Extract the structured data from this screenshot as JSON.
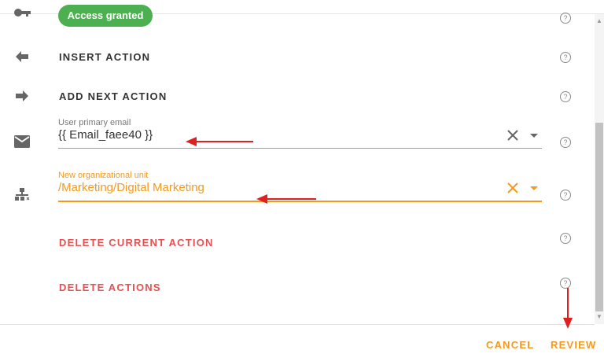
{
  "status_pill": {
    "label": "Access granted",
    "color": "#4caf50"
  },
  "actions": {
    "insert_label": "INSERT ACTION",
    "add_next_label": "ADD NEXT ACTION",
    "delete_current_label": "DELETE CURRENT ACTION",
    "delete_all_label": "DELETE ACTIONS"
  },
  "fields": {
    "email": {
      "label": "User primary email",
      "value": "{{ Email_faee40 }}",
      "icon": "email-icon"
    },
    "org_unit": {
      "label": "New organizational unit",
      "value": "/Marketing/Digital Marketing",
      "icon": "org-chart-icon"
    }
  },
  "help_glyph": "?",
  "footer": {
    "cancel_label": "CANCEL",
    "review_label": "REVIEW"
  },
  "colors": {
    "accent": "#f39a1e",
    "danger": "#e65050",
    "annotation_arrow": "#e02020"
  }
}
